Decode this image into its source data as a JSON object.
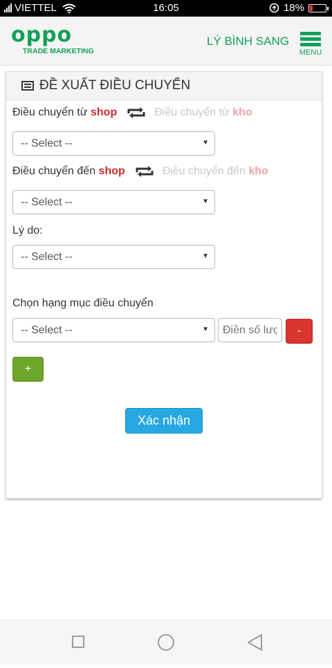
{
  "status_bar": {
    "carrier": "VIETTEL",
    "time": "16:05",
    "battery": "18%",
    "battery_level": 0.18,
    "icons": [
      "signal-icon",
      "wifi-icon",
      "sync-icon",
      "battery-icon"
    ]
  },
  "header": {
    "logo": "oppo",
    "logo_sub": "TRADE MARKETING",
    "user_name": "LÝ BÌNH SANG",
    "menu_label": "MENU",
    "brand_color": "#13a05a"
  },
  "panel": {
    "title": "ĐỀ XUẤT ĐIỀU CHUYỂN",
    "from": {
      "label": "Điều chuyển từ",
      "shop": "shop",
      "alt_label": "Điều chuyển từ",
      "alt_kho": "kho",
      "select_value": "-- Select --"
    },
    "to": {
      "label": "Điều chuyển đến",
      "shop": "shop",
      "alt_label": "Điều chuyển đến",
      "alt_kho": "kho",
      "select_value": "-- Select --"
    },
    "reason": {
      "label": "Lý do:",
      "select_value": "-- Select --"
    },
    "category": {
      "label": "Chọn hạng mục điều chuyển",
      "select_value": "-- Select --",
      "qty_placeholder": "Điền số lượng",
      "remove_label": "-"
    },
    "add_label": "+",
    "confirm_label": "Xác nhận"
  },
  "colors": {
    "accent_red": "#d0282a",
    "confirm_blue": "#27a8e2",
    "add_green": "#6ea52b",
    "remove_red": "#d93531"
  }
}
